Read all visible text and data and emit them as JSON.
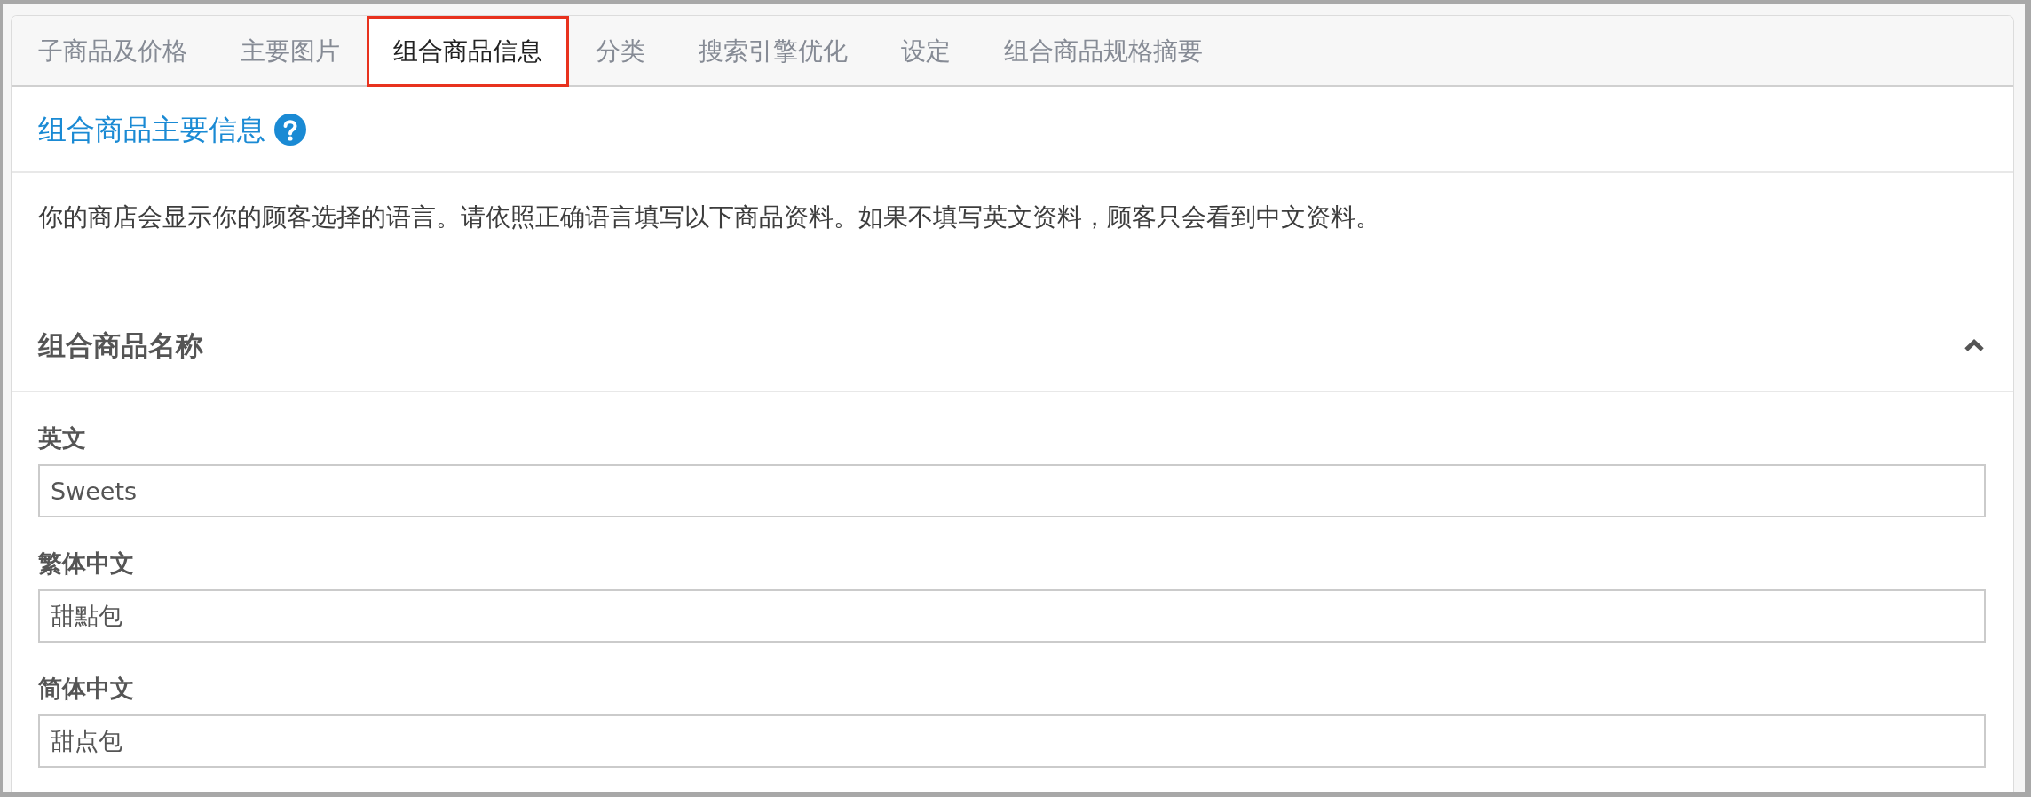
{
  "tabs": [
    {
      "label": "子商品及价格",
      "selected": false
    },
    {
      "label": "主要图片",
      "selected": false
    },
    {
      "label": "组合商品信息",
      "selected": true
    },
    {
      "label": "分类",
      "selected": false
    },
    {
      "label": "搜索引擎优化",
      "selected": false
    },
    {
      "label": "设定",
      "selected": false
    },
    {
      "label": "组合商品规格摘要",
      "selected": false
    }
  ],
  "section": {
    "title": "组合商品主要信息",
    "notice": "你的商店会显示你的顾客选择的语言。请依照正确语言填写以下商品资料。如果不填写英文资料，顾客只会看到中文资料。"
  },
  "name_group": {
    "title": "组合商品名称",
    "expanded": true,
    "fields": [
      {
        "label": "英文",
        "value": "Sweets"
      },
      {
        "label": "繁体中文",
        "value": "甜點包"
      },
      {
        "label": "简体中文",
        "value": "甜点包"
      }
    ]
  }
}
